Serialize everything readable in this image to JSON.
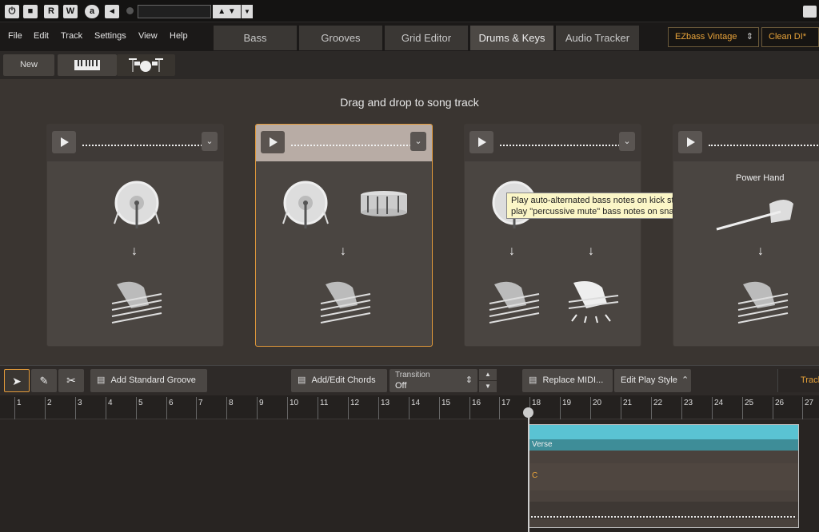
{
  "topbar": {
    "buttons": [
      "R",
      "W"
    ],
    "timecode": ""
  },
  "menu": [
    "File",
    "Edit",
    "Track",
    "Settings",
    "View",
    "Help"
  ],
  "tabs": [
    {
      "label": "Bass",
      "active": false
    },
    {
      "label": "Grooves",
      "active": false
    },
    {
      "label": "Grid Editor",
      "active": false
    },
    {
      "label": "Drums & Keys",
      "active": true
    },
    {
      "label": "Audio Tracker",
      "active": false
    }
  ],
  "presets": {
    "instrument": "EZbass Vintage",
    "sound": "Clean DI*"
  },
  "toolrow": {
    "new_label": "New"
  },
  "stage": {
    "heading": "Drag and drop to song track",
    "cards": [
      {
        "kick": true,
        "snare": false,
        "power_hand_label": ""
      },
      {
        "kick": true,
        "snare": true,
        "power_hand_label": ""
      },
      {
        "kick": true,
        "snare": true,
        "power_hand_label": ""
      },
      {
        "kick": false,
        "snare": false,
        "power_hand_label": "Power Hand"
      }
    ],
    "tooltip": "Play auto-alternated bass notes on kick strokes, and play \"percussive mute\" bass notes on snare strokes"
  },
  "bottom": {
    "add_groove": "Add Standard Groove",
    "add_chords": "Add/Edit Chords",
    "transition_label": "Transition",
    "transition_value": "Off",
    "replace_midi": "Replace MIDI...",
    "edit_play_style": "Edit Play Style",
    "track_label": "Track"
  },
  "ruler": {
    "bars": [
      "1",
      "2",
      "3",
      "4",
      "5",
      "6",
      "7",
      "8",
      "9",
      "10",
      "11",
      "12",
      "13",
      "14",
      "15",
      "16",
      "17",
      "18",
      "19",
      "20",
      "21",
      "22",
      "23",
      "24",
      "25",
      "26",
      "27"
    ]
  },
  "song": {
    "section_label": "Verse",
    "chord": "C"
  }
}
